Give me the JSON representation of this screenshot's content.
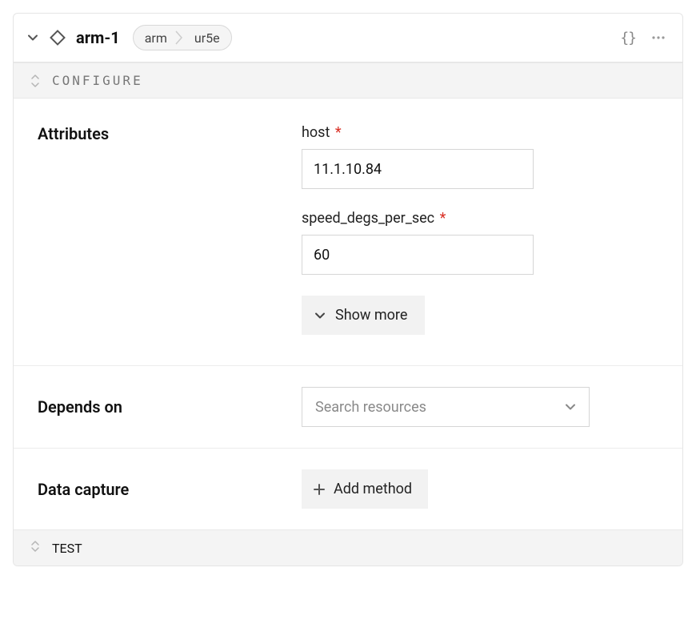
{
  "header": {
    "resource_name": "arm-1",
    "breadcrumb": {
      "api": "arm",
      "model": "ur5e"
    }
  },
  "sections": {
    "configure": {
      "title": "CONFIGURE",
      "attributes_label": "Attributes",
      "fields": {
        "host": {
          "label": "host",
          "value": "11.1.10.84",
          "required": true
        },
        "speed": {
          "label": "speed_degs_per_sec",
          "value": "60",
          "required": true
        }
      },
      "show_more_label": "Show more"
    },
    "depends": {
      "label": "Depends on",
      "placeholder": "Search resources"
    },
    "capture": {
      "label": "Data capture",
      "add_method_label": "Add method"
    },
    "test": {
      "title": "TEST"
    }
  }
}
